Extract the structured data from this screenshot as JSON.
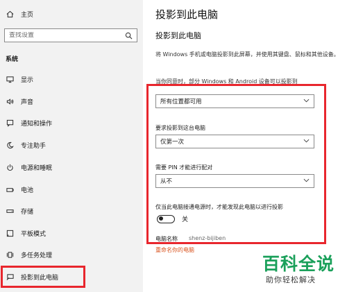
{
  "sidebar": {
    "home_label": "主页",
    "search_placeholder": "查找设置",
    "section_label": "系统",
    "items": [
      {
        "label": "显示",
        "icon": "monitor-icon"
      },
      {
        "label": "声音",
        "icon": "speaker-icon"
      },
      {
        "label": "通知和操作",
        "icon": "notification-icon"
      },
      {
        "label": "专注助手",
        "icon": "moon-icon"
      },
      {
        "label": "电源和睡眠",
        "icon": "power-icon"
      },
      {
        "label": "电池",
        "icon": "battery-icon"
      },
      {
        "label": "存储",
        "icon": "storage-icon"
      },
      {
        "label": "平板模式",
        "icon": "tablet-icon"
      },
      {
        "label": "多任务处理",
        "icon": "multitask-icon"
      },
      {
        "label": "投影到此电脑",
        "icon": "project-icon"
      }
    ],
    "active_item": "投影到此电脑"
  },
  "main": {
    "page_title": "投影到此电脑",
    "sub_title": "投影到此电脑",
    "description": "将 Windows 手机或电脑投影到此屏幕，并使用其键盘、鼠标和其他设备。",
    "description_cut": "当你同意时，部分 Windows 和 Android 设备可以投影到",
    "setting1": {
      "value": "所有位置都可用"
    },
    "setting2": {
      "label": "要求投影到这台电脑",
      "value": "仅第一次"
    },
    "setting3": {
      "label": "需要 PIN 才能进行配对",
      "value": "从不"
    },
    "toggle": {
      "label": "仅当此电脑接通电源时，才能发现此电脑以进行投影",
      "state": "关"
    },
    "pc_name_label": "电脑名称",
    "pc_name_value": "shenz-bijiben",
    "rename_link": "重命名你的电脑"
  },
  "watermark": {
    "name": "百科全说",
    "tagline": "助你轻松解决"
  },
  "colors": {
    "accent": "#0078d7",
    "highlight": "#e8262d",
    "link": "#d9521d",
    "brand": "#1aa05a"
  }
}
